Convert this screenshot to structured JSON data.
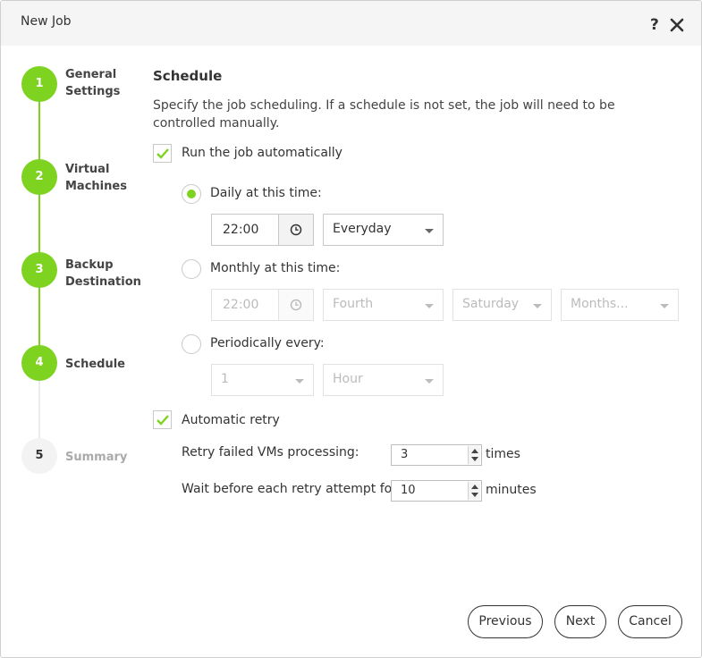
{
  "dialog": {
    "title": "New Job"
  },
  "steps": [
    {
      "number": "1",
      "label": "General Settings"
    },
    {
      "number": "2",
      "label": "Virtual Machines"
    },
    {
      "number": "3",
      "label": "Backup Destination"
    },
    {
      "number": "4",
      "label": "Schedule"
    },
    {
      "number": "5",
      "label": "Summary"
    }
  ],
  "schedule": {
    "heading": "Schedule",
    "description": "Specify the job scheduling. If a schedule is not set, the job will need to be controlled manually.",
    "run_automatically": {
      "label": "Run the job automatically",
      "checked": true
    },
    "daily": {
      "label": "Daily at this time:",
      "selected": true,
      "time": "22:00",
      "frequency": "Everyday"
    },
    "monthly": {
      "label": "Monthly at this time:",
      "selected": false,
      "time": "22:00",
      "week": "Fourth",
      "day": "Saturday",
      "months": "Months..."
    },
    "periodically": {
      "label": "Periodically every:",
      "selected": false,
      "value": "1",
      "unit": "Hour"
    },
    "retry": {
      "label": "Automatic retry",
      "checked": true,
      "failed_label": "Retry failed VMs processing:",
      "failed_value": "3",
      "failed_unit": "times",
      "wait_label": "Wait before each retry attempt for:",
      "wait_value": "10",
      "wait_unit": "minutes"
    }
  },
  "buttons": {
    "previous": "Previous",
    "next": "Next",
    "cancel": "Cancel"
  },
  "colors": {
    "accent": "#7ed321",
    "titlebar": "#f5f5f5"
  }
}
